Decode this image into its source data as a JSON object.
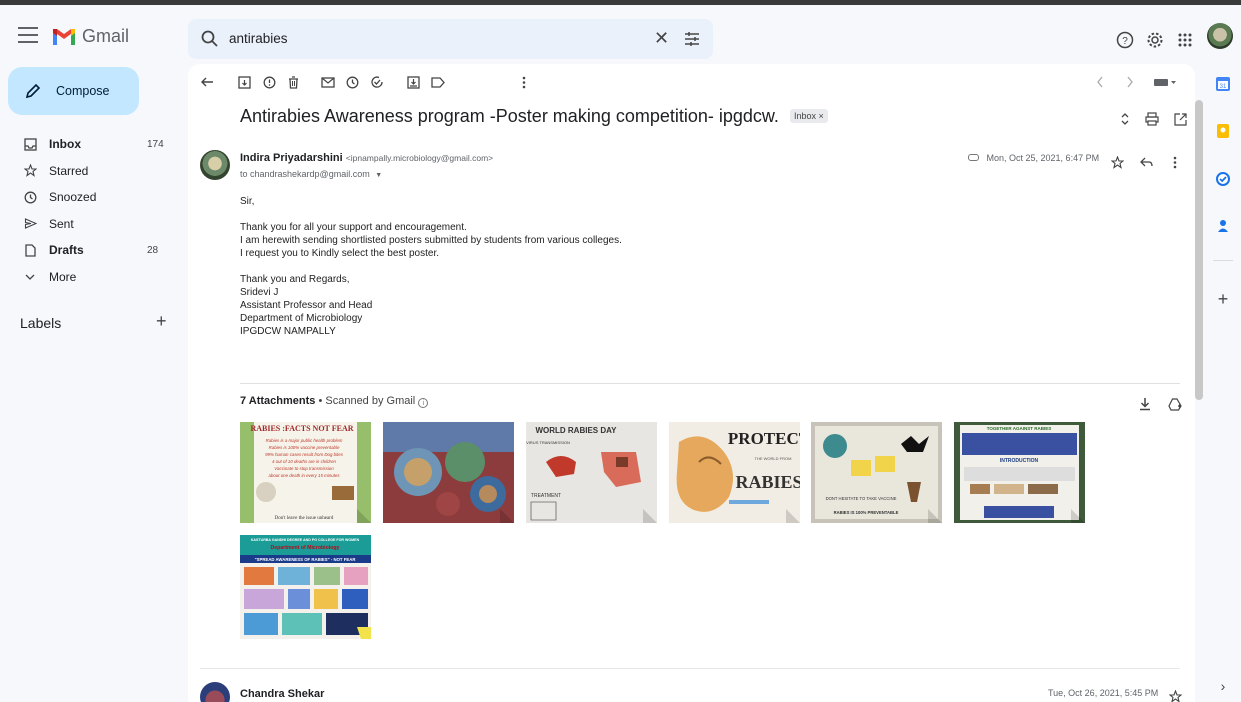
{
  "app": {
    "name": "Gmail"
  },
  "search": {
    "query": "antirabies"
  },
  "compose": {
    "label": "Compose"
  },
  "nav": [
    {
      "label": "Inbox",
      "count": "174",
      "bold": true
    },
    {
      "label": "Starred",
      "count": ""
    },
    {
      "label": "Snoozed",
      "count": ""
    },
    {
      "label": "Sent",
      "count": ""
    },
    {
      "label": "Drafts",
      "count": "28",
      "bold": true
    },
    {
      "label": "More",
      "count": ""
    }
  ],
  "labels_header": "Labels",
  "email": {
    "subject": "Antirabies Awareness program -Poster making competition- ipgdcw.",
    "tag": "Inbox ×",
    "sender_name": "Indira Priyadarshini",
    "sender_email": "<ipnampally.microbiology@gmail.com>",
    "to": "to chandrashekardp@gmail.com",
    "date": "Mon, Oct 25, 2021, 6:47 PM",
    "body": [
      "Sir,",
      "",
      "Thank you for all your support and encouragement.",
      "I am herewith sending shortlisted posters submitted by students from various colleges.",
      "I request you to Kindly select the best poster.",
      "",
      "Thank you and Regards,",
      "Sridevi J",
      "Assistant Professor and Head",
      "Department of Microbiology",
      "IPGDCW NAMPALLY"
    ]
  },
  "attachments": {
    "count_label": "7 Attachments",
    "scanned_label": "Scanned by Gmail",
    "thumb_texts": {
      "t1_title": "RABIES :FACTS NOT FEAR",
      "t1_lines": [
        "Rabies is a major public health problem",
        "Rabies is 100% vaccine preventable",
        "99% human cases result from Dog bites",
        "4 out of 10 deaths are in children",
        "Vaccinate to stop transmission",
        "about one death in every 15 minutes"
      ],
      "t1_footer": "Don't leave the issue unheard",
      "t3_title": "WORLD RABIES DAY",
      "t3_sub": "VIRUS TRANSMISSION",
      "t3_treat": "TREATMENT",
      "t4_title": "PROTECT",
      "t4_sub": "THE WORLD FROM",
      "t4_word": "RABIES",
      "t5_text1": "DONT HESITATE TO TAKE VACCINE",
      "t5_text2": "RABIES IS 100% PREVENTABLE",
      "t6_title": "TOGETHER AGAINST RABIES",
      "t6_intro": "INTRODUCTION",
      "t7_title": "KASTURBA GANDHI DEGREE AND PG COLLEGE FOR WOMEN",
      "t7_dept": "Department of Microbiology",
      "t7_banner": "\"SPREAD AWARENESS OF RABIES\" - NOT FEAR"
    }
  },
  "next_message": {
    "sender_name": "Chandra Shekar",
    "date": "Tue, Oct 26, 2021, 5:45 PM"
  },
  "colors": {
    "accent_compose": "#c2e7ff",
    "search_bg": "#eaf1fb",
    "page_bg": "#f6f8fc"
  }
}
